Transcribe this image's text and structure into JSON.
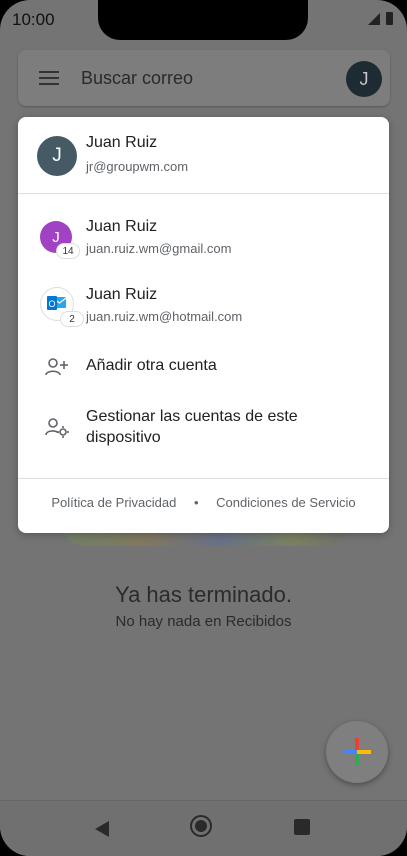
{
  "status": {
    "time": "10:00"
  },
  "search": {
    "placeholder": "Buscar correo",
    "avatar_initial": "J"
  },
  "accounts_panel": {
    "current": {
      "initial": "J",
      "name": "Juan Ruiz",
      "email": "jr@groupwm.com"
    },
    "others": [
      {
        "initial": "J",
        "name": "Juan Ruiz",
        "email": "juan.ruiz.wm@gmail.com",
        "badge": "14",
        "color": "#a142c4"
      },
      {
        "name": "Juan Ruiz",
        "email": "juan.ruiz.wm@hotmail.com",
        "badge": "2",
        "icon": "outlook-icon"
      }
    ],
    "actions": {
      "add_account": "Añadir otra cuenta",
      "manage_accounts": "Gestionar las cuentas de este dispositivo"
    },
    "footer": {
      "privacy": "Política de Privacidad",
      "separator": "•",
      "terms": "Condiciones de Servicio"
    }
  },
  "inbox_empty": {
    "title": "Ya has terminado.",
    "subtitle": "No hay nada en Recibidos"
  },
  "colors": {
    "accent_blue": "#4285f4",
    "accent_red": "#ea4335",
    "accent_yellow": "#fbbc04",
    "accent_green": "#34a853"
  }
}
